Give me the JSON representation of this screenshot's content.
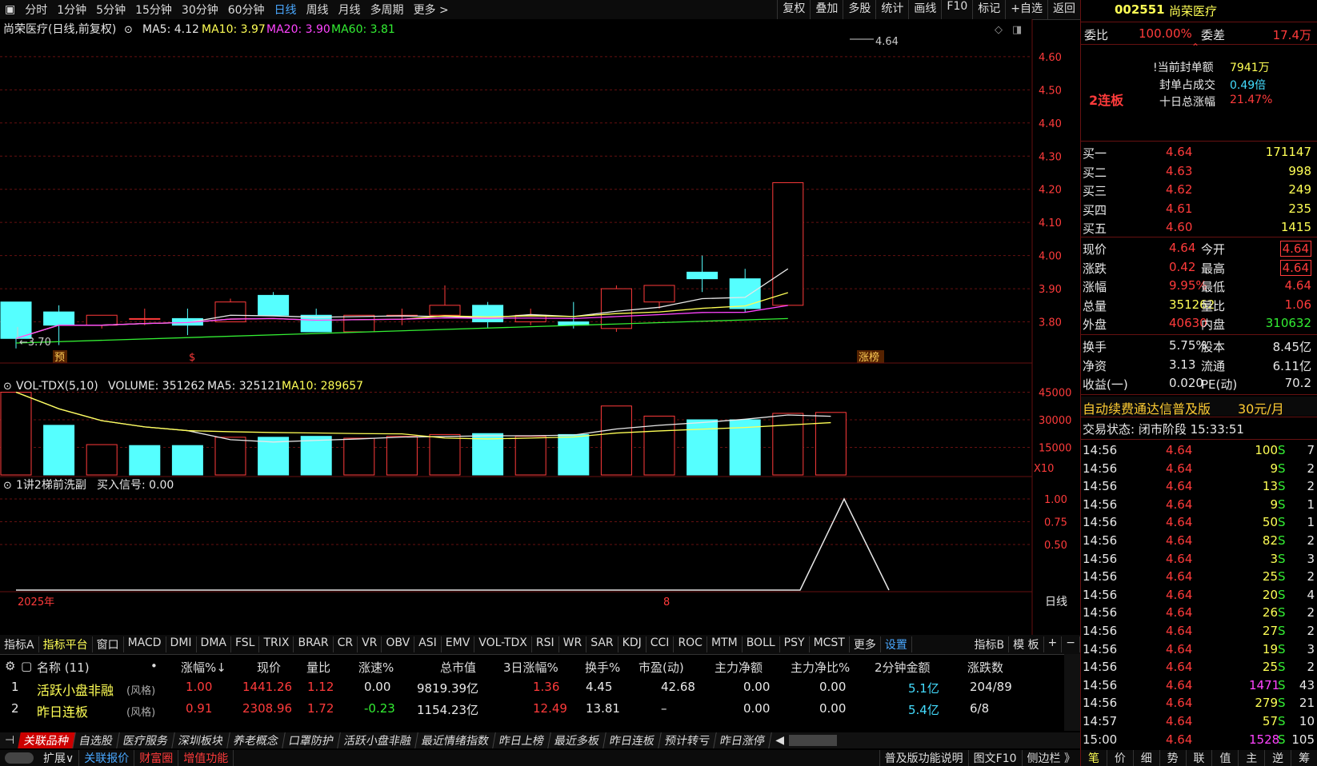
{
  "topbar": {
    "left_items": [
      "分时",
      "1分钟",
      "5分钟",
      "15分钟",
      "30分钟",
      "60分钟",
      "日线",
      "周线",
      "月线",
      "多周期",
      "更多 >"
    ],
    "active_index": 6,
    "right_items": [
      "复权",
      "叠加",
      "多股",
      "统计",
      "画线",
      "F10",
      "标记",
      "+自选",
      "返回"
    ]
  },
  "kline": {
    "title": "尚荣医疗(日线,前复权)",
    "ma5": "MA5: 4.12",
    "ma10": "MA10: 3.97",
    "ma20": "MA20: 3.90",
    "ma60": "MA60: 3.81",
    "hi_mark": "4.64",
    "lo_mark": "3.70",
    "tag_left": "预",
    "tag_mid": "$",
    "tag_right": "涨榜",
    "price_ticks": [
      "4.60",
      "4.50",
      "4.40",
      "4.30",
      "4.20",
      "4.10",
      "4.00",
      "3.90",
      "3.80"
    ],
    "candles": [
      {
        "o": 3.86,
        "c": 3.75,
        "h": 3.86,
        "l": 3.72,
        "up": false
      },
      {
        "o": 3.79,
        "c": 3.83,
        "h": 3.85,
        "l": 3.73,
        "up": false
      },
      {
        "o": 3.82,
        "c": 3.79,
        "h": 3.82,
        "l": 3.78,
        "up": true
      },
      {
        "o": 3.81,
        "c": 3.81,
        "h": 3.84,
        "l": 3.79,
        "up": true
      },
      {
        "o": 3.79,
        "c": 3.81,
        "h": 3.84,
        "l": 3.76,
        "up": false
      },
      {
        "o": 3.8,
        "c": 3.86,
        "h": 3.87,
        "l": 3.8,
        "up": true
      },
      {
        "o": 3.88,
        "c": 3.82,
        "h": 3.89,
        "l": 3.82,
        "up": false
      },
      {
        "o": 3.82,
        "c": 3.77,
        "h": 3.84,
        "l": 3.77,
        "up": false
      },
      {
        "o": 3.77,
        "c": 3.82,
        "h": 3.82,
        "l": 3.77,
        "up": true
      },
      {
        "o": 3.82,
        "c": 3.82,
        "h": 3.84,
        "l": 3.79,
        "up": true
      },
      {
        "o": 3.82,
        "c": 3.85,
        "h": 3.91,
        "l": 3.82,
        "up": true
      },
      {
        "o": 3.85,
        "c": 3.8,
        "h": 3.86,
        "l": 3.78,
        "up": false
      },
      {
        "o": 3.8,
        "c": 3.82,
        "h": 3.84,
        "l": 3.79,
        "up": true
      },
      {
        "o": 3.8,
        "c": 3.79,
        "h": 3.86,
        "l": 3.78,
        "up": false
      },
      {
        "o": 3.78,
        "c": 3.9,
        "h": 3.91,
        "l": 3.77,
        "up": true
      },
      {
        "o": 3.86,
        "c": 3.91,
        "h": 3.91,
        "l": 3.84,
        "up": true
      },
      {
        "o": 3.95,
        "c": 3.93,
        "h": 4.0,
        "l": 3.89,
        "up": false
      },
      {
        "o": 3.93,
        "c": 3.84,
        "h": 3.96,
        "l": 3.83,
        "up": false
      },
      {
        "o": 3.85,
        "c": 4.22,
        "h": 4.22,
        "l": 3.85,
        "up": true
      }
    ]
  },
  "volume": {
    "title": "VOL-TDX(5,10)",
    "vol": "VOLUME: 351262",
    "ma5": "MA5: 325121",
    "ma10": "MA10: 289657",
    "ticks": [
      "45000",
      "30000",
      "15000"
    ],
    "unit": "X10",
    "bars": [
      {
        "v": 45000,
        "up": true
      },
      {
        "v": 27000,
        "up": false
      },
      {
        "v": 16500,
        "up": true
      },
      {
        "v": 16000,
        "up": false
      },
      {
        "v": 16000,
        "up": false
      },
      {
        "v": 20500,
        "up": true
      },
      {
        "v": 20500,
        "up": false
      },
      {
        "v": 21000,
        "up": false
      },
      {
        "v": 20000,
        "up": true
      },
      {
        "v": 21000,
        "up": true
      },
      {
        "v": 22000,
        "up": true
      },
      {
        "v": 22500,
        "up": false
      },
      {
        "v": 21000,
        "up": true
      },
      {
        "v": 22000,
        "up": false
      },
      {
        "v": 37500,
        "up": true
      },
      {
        "v": 32000,
        "up": true
      },
      {
        "v": 30000,
        "up": false
      },
      {
        "v": 30000,
        "up": false
      },
      {
        "v": 33500,
        "up": true
      },
      {
        "v": 34000,
        "up": true
      }
    ]
  },
  "indicator": {
    "title": "1讲2梯前洗副",
    "signal": "买入信号: 0.00",
    "ticks": [
      "1.00",
      "0.75",
      "0.50"
    ],
    "year": "2025年",
    "month": "8",
    "period": "日线"
  },
  "indicator_bar": {
    "items": [
      "指标A",
      "指标平台",
      "窗口",
      "MACD",
      "DMI",
      "DMA",
      "FSL",
      "TRIX",
      "BRAR",
      "CR",
      "VR",
      "OBV",
      "ASI",
      "EMV",
      "VOL-TDX",
      "RSI",
      "WR",
      "SAR",
      "KDJ",
      "CCI",
      "ROC",
      "MTM",
      "BOLL",
      "PSY",
      "MCST",
      "更多",
      "设置"
    ],
    "right_items": [
      "指标B",
      "模 板",
      "+",
      "−"
    ]
  },
  "table": {
    "headers": [
      "名称 (11)",
      "•",
      "涨幅%↓",
      "现价",
      "量比",
      "涨速%",
      "总市值",
      "3日涨幅%",
      "换手%",
      "市盈(动)",
      "主力净额",
      "主力净比%",
      "2分钟金额",
      "涨跌数"
    ],
    "rows": [
      {
        "idx": "1",
        "name": "活跃小盘非融",
        "tag": "(风格)",
        "chg": "1.00",
        "price": "1441.26",
        "vr": "1.12",
        "speed": "0.00",
        "mcap": "9819.39亿",
        "chg3": "1.36",
        "turn": "4.45",
        "pe": "42.68",
        "net": "0.00",
        "netpct": "0.00",
        "amt2": "5.1亿",
        "updn": "204/89"
      },
      {
        "idx": "2",
        "name": "昨日连板",
        "tag": "(风格)",
        "chg": "0.91",
        "price": "2308.96",
        "vr": "1.72",
        "speed": "-0.23",
        "mcap": "1154.23亿",
        "chg3": "12.49",
        "turn": "13.81",
        "pe": "–",
        "net": "0.00",
        "netpct": "0.00",
        "amt2": "5.4亿",
        "updn": "6/8"
      }
    ]
  },
  "tabs": [
    "关联品种",
    "自选股",
    "医疗服务",
    "深圳板块",
    "养老概念",
    "口罩防护",
    "活跃小盘非融",
    "最近情绪指数",
    "昨日上榜",
    "最近多板",
    "昨日连板",
    "预计转亏",
    "昨日涨停"
  ],
  "statusbar": {
    "items": [
      "扩展∨",
      "关联报价",
      "财富圈",
      "增值功能"
    ],
    "right": [
      "普及版功能说明",
      "图文F10",
      "侧边栏 》"
    ]
  },
  "side": {
    "code": "002551",
    "name": "尚荣医疗",
    "weibi_label": "委比",
    "weibi": "100.00%",
    "weicha_label": "委差",
    "weicha": "17.4万",
    "streak": "2连板",
    "seal_label": "当前封单额",
    "seal": "7941万",
    "seal_ratio_label": "封单占成交",
    "seal_ratio": "0.49倍",
    "ten_day_label": "十日总涨幅",
    "ten_day": "21.47%",
    "bids": [
      {
        "label": "买一",
        "price": "4.64",
        "vol": "171147"
      },
      {
        "label": "买二",
        "price": "4.63",
        "vol": "998"
      },
      {
        "label": "买三",
        "price": "4.62",
        "vol": "249"
      },
      {
        "label": "买四",
        "price": "4.61",
        "vol": "235"
      },
      {
        "label": "买五",
        "price": "4.60",
        "vol": "1415"
      }
    ],
    "quote": [
      {
        "l1": "现价",
        "v1": "4.64",
        "l2": "今开",
        "v2": "4.64"
      },
      {
        "l1": "涨跌",
        "v1": "0.42",
        "l2": "最高",
        "v2": "4.64"
      },
      {
        "l1": "涨幅",
        "v1": "9.95%",
        "l2": "最低",
        "v2": "4.64"
      },
      {
        "l1": "总量",
        "v1": "351262",
        "l2": "量比",
        "v2": "1.06"
      },
      {
        "l1": "外盘",
        "v1": "40630",
        "l2": "内盘",
        "v2": "310632"
      }
    ],
    "fund": [
      {
        "l1": "换手",
        "v1": "5.75%",
        "l2": "股本",
        "v2": "8.45亿"
      },
      {
        "l1": "净资",
        "v1": "3.13",
        "l2": "流通",
        "v2": "6.11亿"
      },
      {
        "l1": "收益(一)",
        "v1": "0.020",
        "l2": "PE(动)",
        "v2": "70.2"
      }
    ],
    "promo": "自动续费通达信普及版",
    "promo_price": "30元/月",
    "trade_status": "交易状态: 闭市阶段 15:33:51",
    "ticks": [
      {
        "t": "14:56",
        "p": "4.64",
        "v": "100",
        "s": "S",
        "n": "7"
      },
      {
        "t": "14:56",
        "p": "4.64",
        "v": "9",
        "s": "S",
        "n": "2"
      },
      {
        "t": "14:56",
        "p": "4.64",
        "v": "13",
        "s": "S",
        "n": "2"
      },
      {
        "t": "14:56",
        "p": "4.64",
        "v": "9",
        "s": "S",
        "n": "1"
      },
      {
        "t": "14:56",
        "p": "4.64",
        "v": "50",
        "s": "S",
        "n": "1"
      },
      {
        "t": "14:56",
        "p": "4.64",
        "v": "82",
        "s": "S",
        "n": "2"
      },
      {
        "t": "14:56",
        "p": "4.64",
        "v": "3",
        "s": "S",
        "n": "3"
      },
      {
        "t": "14:56",
        "p": "4.64",
        "v": "25",
        "s": "S",
        "n": "2"
      },
      {
        "t": "14:56",
        "p": "4.64",
        "v": "20",
        "s": "S",
        "n": "4"
      },
      {
        "t": "14:56",
        "p": "4.64",
        "v": "26",
        "s": "S",
        "n": "2"
      },
      {
        "t": "14:56",
        "p": "4.64",
        "v": "27",
        "s": "S",
        "n": "2"
      },
      {
        "t": "14:56",
        "p": "4.64",
        "v": "19",
        "s": "S",
        "n": "3"
      },
      {
        "t": "14:56",
        "p": "4.64",
        "v": "25",
        "s": "S",
        "n": "2"
      },
      {
        "t": "14:56",
        "p": "4.64",
        "v": "1471",
        "s": "S",
        "n": "43"
      },
      {
        "t": "14:56",
        "p": "4.64",
        "v": "279",
        "s": "S",
        "n": "21"
      },
      {
        "t": "14:57",
        "p": "4.64",
        "v": "57",
        "s": "S",
        "n": "10"
      },
      {
        "t": "15:00",
        "p": "4.64",
        "v": "1528",
        "s": "S",
        "n": "105"
      }
    ],
    "bottom_tabs": [
      "笔",
      "价",
      "细",
      "势",
      "联",
      "值",
      "主",
      "逆",
      "筹"
    ]
  }
}
